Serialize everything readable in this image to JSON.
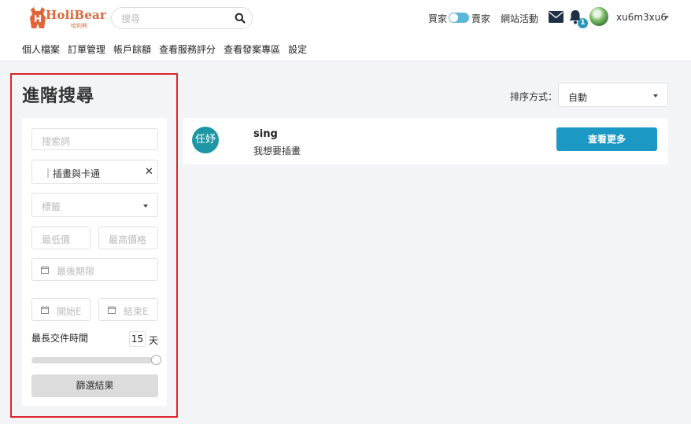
{
  "header": {
    "logo_text": "HoliBear",
    "logo_sub": "哈利熊",
    "search_placeholder": "搜尋",
    "role_buyer": "買家",
    "role_seller": "賣家",
    "site_events": "網站活動",
    "notification_count": "1",
    "username": "xu6m3xu6"
  },
  "nav": {
    "items": [
      "個人檔案",
      "訂單管理",
      "帳戶餘額",
      "查看服務評分",
      "查看發案專區",
      "設定"
    ]
  },
  "sidebar": {
    "title": "進階搜尋",
    "keyword_placeholder": "搜索詞",
    "category_value": "｜插畫與卡通",
    "tags_placeholder": "標籤",
    "min_price_placeholder": "最低價",
    "max_price_placeholder": "最高價格",
    "deadline_placeholder": "最後期限",
    "start_date_placeholder": "開始E",
    "end_date_placeholder": "結束E",
    "doc_time_label": "最長交件時間",
    "doc_time_value": "15",
    "doc_time_unit": "天",
    "slider_fraction": 1.0,
    "filter_button": "篩選結果"
  },
  "sort": {
    "label": "排序方式：",
    "value": "自動"
  },
  "results": [
    {
      "avatar_text": "任妤",
      "title": "sing",
      "description": "我想要插畫",
      "button": "查看更多"
    }
  ],
  "colors": {
    "brand": "#e0663a",
    "accent": "#1b98c4",
    "highlight_frame": "#d9262e",
    "avatar_bg": "#1e97a4"
  }
}
